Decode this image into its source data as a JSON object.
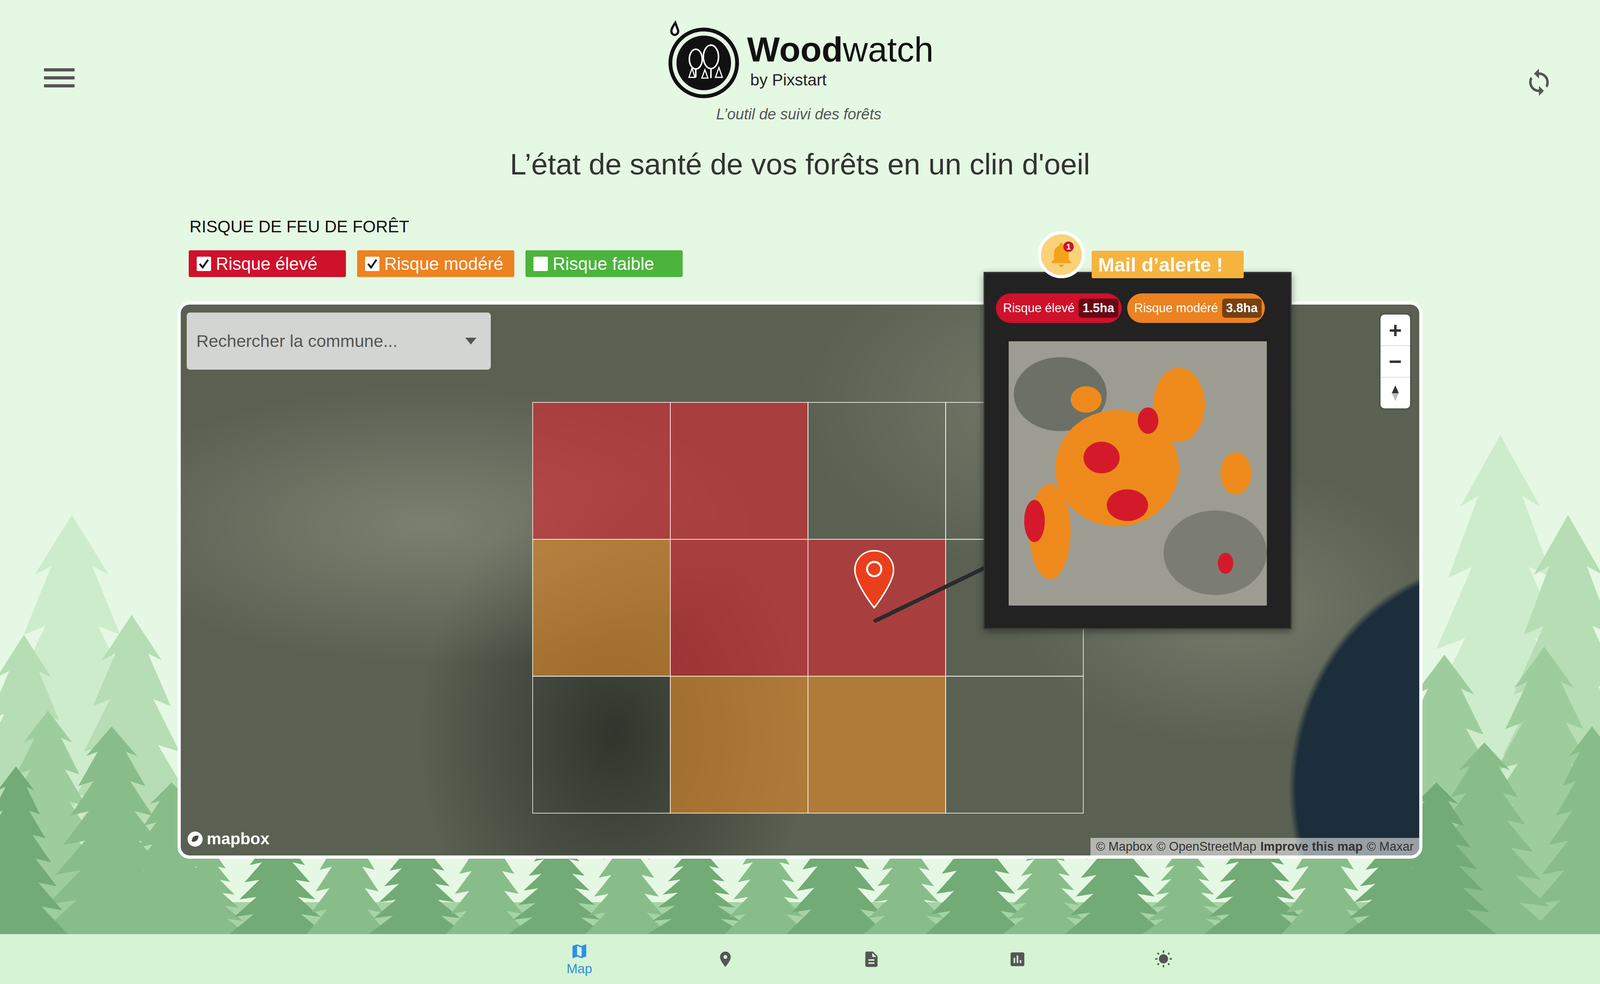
{
  "header": {
    "brand_bold": "Wood",
    "brand_regular": "watch",
    "byline": "by Pixstart",
    "tagline": "L’outil de suivi des forêts"
  },
  "headline": "L’état de santé de vos forêts en un clin d'oeil",
  "filters": {
    "title": "RISQUE DE FEU DE FORÊT",
    "items": [
      {
        "label": "Risque élevé",
        "checked": true,
        "color": "#d0112b"
      },
      {
        "label": "Risque modéré",
        "checked": true,
        "color": "#ec8222"
      },
      {
        "label": "Risque faible",
        "checked": false,
        "color": "#4cb43c"
      }
    ]
  },
  "map": {
    "search": {
      "placeholder": "Rechercher la commune..."
    },
    "zoom": {
      "in": "+",
      "out": "−"
    },
    "logo": "mapbox",
    "attribution": [
      {
        "text": "© Mapbox",
        "bold": false
      },
      {
        "text": "© OpenStreetMap",
        "bold": false
      },
      {
        "text": "Improve this map",
        "bold": true
      },
      {
        "text": "© Maxar",
        "bold": false
      }
    ],
    "cells": [
      {
        "risk": "high",
        "pinned": false
      },
      {
        "risk": "high",
        "pinned": false
      },
      {
        "risk": "none",
        "pinned": false
      },
      {
        "risk": "none",
        "pinned": false
      },
      {
        "risk": "moderate",
        "pinned": false
      },
      {
        "risk": "high",
        "pinned": false
      },
      {
        "risk": "high",
        "pinned": true
      },
      {
        "risk": "none",
        "pinned": false
      },
      {
        "risk": "none",
        "pinned": false
      },
      {
        "risk": "moderate",
        "pinned": false
      },
      {
        "risk": "moderate",
        "pinned": false
      },
      {
        "risk": "none",
        "pinned": false
      }
    ]
  },
  "alert": {
    "title": "Mail d’alerte !",
    "count": "1",
    "badges": [
      {
        "label": "Risque élevé",
        "value": "1.5ha",
        "color": "#d0112b"
      },
      {
        "label": "Risque modéré",
        "value": "3.8ha",
        "color": "#ec8222"
      }
    ]
  },
  "nav": {
    "items": [
      {
        "label": "Map",
        "selected": true
      },
      {
        "selected": false
      },
      {
        "selected": false
      },
      {
        "selected": false
      },
      {
        "selected": false
      }
    ]
  }
}
